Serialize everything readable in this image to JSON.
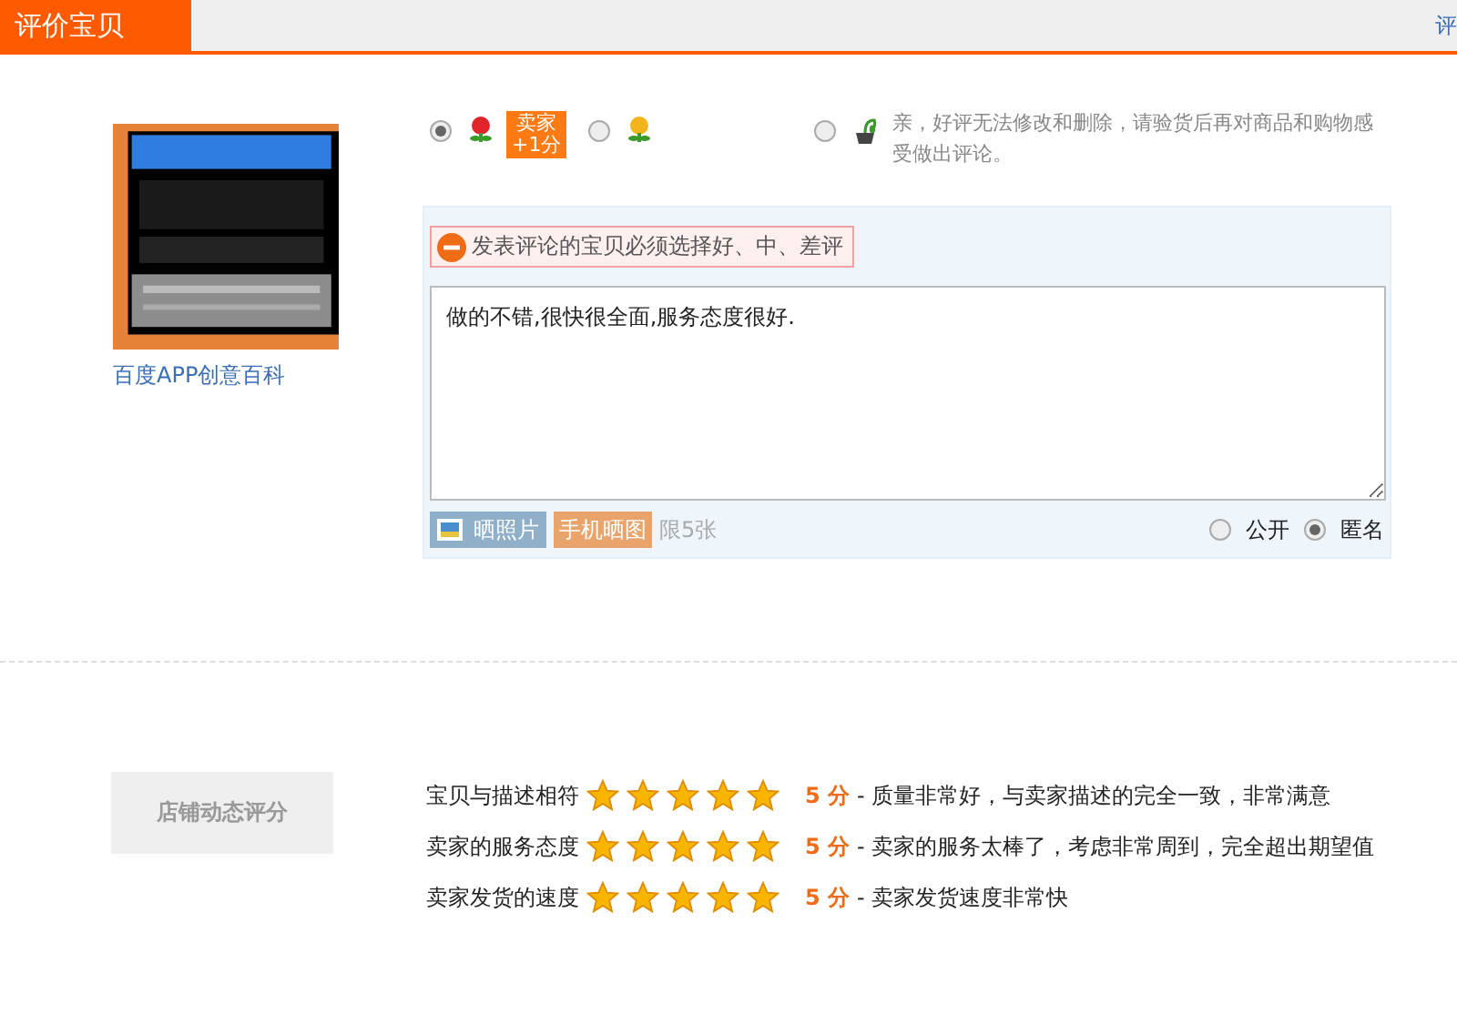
{
  "header": {
    "title": "评价宝贝",
    "right_text": "评"
  },
  "product": {
    "name": "百度APP创意百科"
  },
  "ratings": [
    {
      "kind": "good",
      "selected": true,
      "badge": "卖家\n+1分"
    },
    {
      "kind": "neutral",
      "selected": false
    },
    {
      "kind": "bad",
      "selected": false
    }
  ],
  "notice": "亲，好评无法修改和删除，请验货后再对商品和购物感受做出评论。",
  "error": "发表评论的宝贝必须选择好、中、差评",
  "comment": "做的不错,很快很全面,服务态度很好.",
  "upload": {
    "photo_button": "晒照片",
    "mobile_button": "手机晒图",
    "limit": "限5张"
  },
  "visibility": [
    {
      "label": "公开",
      "selected": false
    },
    {
      "label": "匿名",
      "selected": true
    }
  ],
  "shop_rating": {
    "title": "店铺动态评分",
    "rows": [
      {
        "label": "宝贝与描述相符",
        "stars": 5,
        "score": "5 分",
        "desc": "- 质量非常好，与卖家描述的完全一致，非常满意"
      },
      {
        "label": "卖家的服务态度",
        "stars": 5,
        "score": "5 分",
        "desc": "- 卖家的服务太棒了，考虑非常周到，完全超出期望值"
      },
      {
        "label": "卖家发货的速度",
        "stars": 5,
        "score": "5 分",
        "desc": "- 卖家发货速度非常快"
      }
    ]
  }
}
